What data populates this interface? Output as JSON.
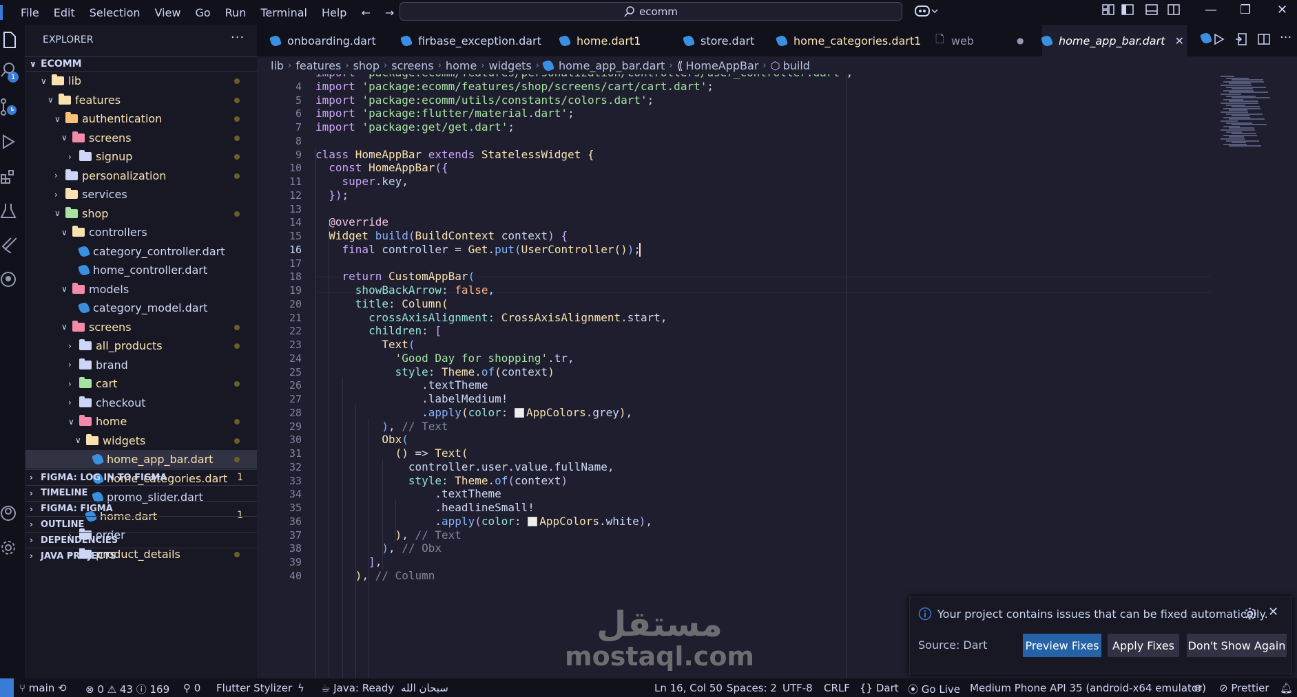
{
  "titlebar": {
    "menu": [
      "File",
      "Edit",
      "Selection",
      "View",
      "Go",
      "Run",
      "Terminal",
      "Help"
    ],
    "search": "ecomm"
  },
  "activity": {
    "badge": "1"
  },
  "sidebar": {
    "title": "EXPLORER",
    "more": "···",
    "root": "ECOMM",
    "tree": [
      {
        "label": "lib",
        "depth": 1,
        "type": "folder",
        "open": true,
        "dot": true,
        "color": "#f9e2af"
      },
      {
        "label": "features",
        "depth": 2,
        "type": "folder",
        "open": true,
        "dot": true,
        "color": "#f9e2af"
      },
      {
        "label": "authentication",
        "depth": 3,
        "type": "folder",
        "open": true,
        "dot": true,
        "color": "#f9c27a"
      },
      {
        "label": "screens",
        "depth": 4,
        "type": "folder",
        "open": true,
        "dot": true,
        "color": "#f38ba8"
      },
      {
        "label": "signup",
        "depth": 5,
        "type": "folder",
        "open": false,
        "dot": true,
        "color": "#cdd6f4"
      },
      {
        "label": "personalization",
        "depth": 3,
        "type": "folder",
        "open": false,
        "dot": true,
        "color": "#cdd6f4"
      },
      {
        "label": "services",
        "depth": 3,
        "type": "folder",
        "open": false,
        "dot": false,
        "color": "#f9e2af"
      },
      {
        "label": "shop",
        "depth": 3,
        "type": "folder",
        "open": true,
        "dot": true,
        "color": "#a6e3a1"
      },
      {
        "label": "controllers",
        "depth": 4,
        "type": "folder",
        "open": true,
        "dot": false,
        "color": "#f9e2af"
      },
      {
        "label": "category_controller.dart",
        "depth": 5,
        "type": "dart",
        "dot": false
      },
      {
        "label": "home_controller.dart",
        "depth": 5,
        "type": "dart",
        "dot": false
      },
      {
        "label": "models",
        "depth": 4,
        "type": "folder",
        "open": true,
        "dot": false,
        "color": "#f38ba8"
      },
      {
        "label": "category_model.dart",
        "depth": 5,
        "type": "dart",
        "dot": false
      },
      {
        "label": "screens",
        "depth": 4,
        "type": "folder",
        "open": true,
        "dot": true,
        "color": "#f38ba8"
      },
      {
        "label": "all_products",
        "depth": 5,
        "type": "folder",
        "open": false,
        "dot": true,
        "color": "#cdd6f4"
      },
      {
        "label": "brand",
        "depth": 5,
        "type": "folder",
        "open": false,
        "dot": false,
        "color": "#cdd6f4"
      },
      {
        "label": "cart",
        "depth": 5,
        "type": "folder",
        "open": false,
        "dot": true,
        "color": "#a6e3a1"
      },
      {
        "label": "checkout",
        "depth": 5,
        "type": "folder",
        "open": false,
        "dot": false,
        "color": "#cdd6f4"
      },
      {
        "label": "home",
        "depth": 5,
        "type": "folder",
        "open": true,
        "dot": true,
        "color": "#f38ba8"
      },
      {
        "label": "widgets",
        "depth": 6,
        "type": "folder",
        "open": true,
        "dot": true,
        "color": "#f9e2af"
      },
      {
        "label": "home_app_bar.dart",
        "depth": 7,
        "type": "dart",
        "dot": true,
        "selected": true
      },
      {
        "label": "home_categories.dart",
        "depth": 7,
        "type": "dart",
        "num": "1"
      },
      {
        "label": "promo_slider.dart",
        "depth": 7,
        "type": "dart",
        "dot": false
      },
      {
        "label": "home.dart",
        "depth": 6,
        "type": "dart",
        "num": "1"
      },
      {
        "label": "order",
        "depth": 5,
        "type": "folder",
        "open": false,
        "dot": false,
        "color": "#cdd6f4"
      },
      {
        "label": "product_details",
        "depth": 5,
        "type": "folder",
        "open": false,
        "dot": true,
        "color": "#cdd6f4"
      }
    ],
    "panels": [
      "FIGMA: LOG IN TO FIGMA",
      "TIMELINE",
      "FIGMA: FIGMA",
      "OUTLINE",
      "DEPENDENCIES",
      "JAVA PROJECTS"
    ]
  },
  "tabs": [
    {
      "label": "onboarding.dart",
      "suffix": "",
      "color": "#cdd6f4",
      "icon": "dart"
    },
    {
      "label": "firbase_exception.dart",
      "suffix": "",
      "color": "#cdd6f4",
      "icon": "dart"
    },
    {
      "label": "home.dart",
      "suffix": " 1",
      "color": "#f9e2af",
      "icon": "dart"
    },
    {
      "label": "store.dart",
      "suffix": "",
      "color": "#cdd6f4",
      "icon": "dart"
    },
    {
      "label": "home_categories.dart",
      "suffix": " 1",
      "color": "#f9e2af",
      "icon": "dart"
    },
    {
      "label": "web",
      "suffix": "",
      "color": "#9399b2",
      "icon": "file"
    },
    {
      "label": "home_app_bar.dart",
      "suffix": "",
      "color": "#ffffff",
      "icon": "dart",
      "active": true
    }
  ],
  "breadcrumb": [
    "lib",
    "features",
    "shop",
    "screens",
    "home",
    "widgets",
    "home_app_bar.dart",
    "HomeAppBar",
    "build"
  ],
  "editor": {
    "line_start": 3,
    "current_line": 16,
    "lines": [
      [
        [
          "kw",
          "import "
        ],
        [
          "st",
          "'package:ecomm/features/personalization/controllers/user_controller.dart'"
        ],
        [
          "pr",
          ";"
        ]
      ],
      [
        [
          "kw",
          "import "
        ],
        [
          "st",
          "'package:ecomm/features/shop/screens/cart/cart.dart'"
        ],
        [
          "pr",
          ";"
        ]
      ],
      [
        [
          "kw",
          "import "
        ],
        [
          "st",
          "'package:ecomm/utils/constants/colors.dart'"
        ],
        [
          "pr",
          ";"
        ]
      ],
      [
        [
          "kw",
          "import "
        ],
        [
          "st",
          "'package:flutter/material.dart'"
        ],
        [
          "pr",
          ";"
        ]
      ],
      [
        [
          "kw",
          "import "
        ],
        [
          "st",
          "'package:get/get.dart'"
        ],
        [
          "pr",
          ";"
        ]
      ],
      [],
      [
        [
          "kw",
          "class "
        ],
        [
          "ty",
          "HomeAppBar "
        ],
        [
          "kw",
          "extends "
        ],
        [
          "ty",
          "StatelessWidget "
        ],
        [
          "br1",
          "{"
        ]
      ],
      [
        [
          "pr",
          "  "
        ],
        [
          "kw",
          "const "
        ],
        [
          "ty",
          "HomeAppBar"
        ],
        [
          "br2",
          "({"
        ]
      ],
      [
        [
          "pr",
          "    "
        ],
        [
          "kw",
          "super"
        ],
        [
          "pr",
          ".key,"
        ]
      ],
      [
        [
          "pr",
          "  "
        ],
        [
          "br2",
          "})"
        ],
        [
          "pr",
          ";"
        ]
      ],
      [],
      [
        [
          "pr",
          "  "
        ],
        [
          "an",
          "@override"
        ]
      ],
      [
        [
          "pr",
          "  "
        ],
        [
          "ty",
          "Widget "
        ],
        [
          "fn",
          "build"
        ],
        [
          "br2",
          "("
        ],
        [
          "ty",
          "BuildContext "
        ],
        [
          "pr",
          "context"
        ],
        [
          "br2",
          ")"
        ],
        [
          "pr",
          " "
        ],
        [
          "br2",
          "{"
        ]
      ],
      [
        [
          "pr",
          "    "
        ],
        [
          "kw",
          "final "
        ],
        [
          "pr",
          "controller = "
        ],
        [
          "ty",
          "Get"
        ],
        [
          "pr",
          "."
        ],
        [
          "fn",
          "put"
        ],
        [
          "br3",
          "("
        ],
        [
          "ty",
          "UserController"
        ],
        [
          "br1",
          "()"
        ],
        [
          "br3",
          ")"
        ],
        [
          "pr",
          ";"
        ]
      ],
      [],
      [
        [
          "pr",
          "    "
        ],
        [
          "kw",
          "return "
        ],
        [
          "ty",
          "CustomAppBar"
        ],
        [
          "br3",
          "("
        ]
      ],
      [
        [
          "pr",
          "      "
        ],
        [
          "pn",
          "showBackArrow"
        ],
        [
          "pr",
          ": "
        ],
        [
          "bo",
          "false"
        ],
        [
          "pr",
          ","
        ]
      ],
      [
        [
          "pr",
          "      "
        ],
        [
          "pn",
          "title"
        ],
        [
          "pr",
          ": "
        ],
        [
          "ty",
          "Column"
        ],
        [
          "br1",
          "("
        ]
      ],
      [
        [
          "pr",
          "        "
        ],
        [
          "pn",
          "crossAxisAlignment"
        ],
        [
          "pr",
          ": "
        ],
        [
          "ty",
          "CrossAxisAlignment"
        ],
        [
          "pr",
          ".start,"
        ]
      ],
      [
        [
          "pr",
          "        "
        ],
        [
          "pn",
          "children"
        ],
        [
          "pr",
          ": "
        ],
        [
          "br2",
          "["
        ]
      ],
      [
        [
          "pr",
          "          "
        ],
        [
          "ty",
          "Text"
        ],
        [
          "br3",
          "("
        ]
      ],
      [
        [
          "pr",
          "            "
        ],
        [
          "st",
          "'Good Day for shopping'"
        ],
        [
          "pr",
          ".tr,"
        ]
      ],
      [
        [
          "pr",
          "            "
        ],
        [
          "pn",
          "style"
        ],
        [
          "pr",
          ": "
        ],
        [
          "ty",
          "Theme"
        ],
        [
          "pr",
          "."
        ],
        [
          "fn",
          "of"
        ],
        [
          "br1",
          "("
        ],
        [
          "pr",
          "context"
        ],
        [
          "br1",
          ")"
        ]
      ],
      [
        [
          "pr",
          "                ."
        ],
        [
          "pr",
          "textTheme"
        ]
      ],
      [
        [
          "pr",
          "                ."
        ],
        [
          "pr",
          "labelMedium!"
        ]
      ],
      [
        [
          "pr",
          "                ."
        ],
        [
          "fn",
          "apply"
        ],
        [
          "br1",
          "("
        ],
        [
          "pn",
          "color"
        ],
        [
          "pr",
          ": "
        ],
        [
          "sw",
          ""
        ],
        [
          "ty",
          "AppColors"
        ],
        [
          "pr",
          ".grey"
        ],
        [
          "br1",
          ")"
        ],
        [
          "pr",
          ","
        ]
      ],
      [
        [
          "pr",
          "          "
        ],
        [
          "br3",
          ")"
        ],
        [
          "pr",
          ", "
        ],
        [
          "cm",
          "// Text"
        ]
      ],
      [
        [
          "pr",
          "          "
        ],
        [
          "ty",
          "Obx"
        ],
        [
          "br3",
          "("
        ]
      ],
      [
        [
          "pr",
          "            "
        ],
        [
          "br1",
          "()"
        ],
        [
          "pr",
          " => "
        ],
        [
          "ty",
          "Text"
        ],
        [
          "br1",
          "("
        ]
      ],
      [
        [
          "pr",
          "              "
        ],
        [
          "pr",
          "controller.user.value.fullName,"
        ]
      ],
      [
        [
          "pr",
          "              "
        ],
        [
          "pn",
          "style"
        ],
        [
          "pr",
          ": "
        ],
        [
          "ty",
          "Theme"
        ],
        [
          "pr",
          "."
        ],
        [
          "fn",
          "of"
        ],
        [
          "br2",
          "("
        ],
        [
          "pr",
          "context"
        ],
        [
          "br2",
          ")"
        ]
      ],
      [
        [
          "pr",
          "                  ."
        ],
        [
          "pr",
          "textTheme"
        ]
      ],
      [
        [
          "pr",
          "                  ."
        ],
        [
          "pr",
          "headlineSmall!"
        ]
      ],
      [
        [
          "pr",
          "                  ."
        ],
        [
          "fn",
          "apply"
        ],
        [
          "br2",
          "("
        ],
        [
          "pn",
          "color"
        ],
        [
          "pr",
          ": "
        ],
        [
          "sw",
          ""
        ],
        [
          "ty",
          "AppColors"
        ],
        [
          "pr",
          ".white"
        ],
        [
          "br2",
          ")"
        ],
        [
          "pr",
          ","
        ]
      ],
      [
        [
          "pr",
          "            "
        ],
        [
          "br1",
          ")"
        ],
        [
          "pr",
          ", "
        ],
        [
          "cm",
          "// Text"
        ]
      ],
      [
        [
          "pr",
          "          "
        ],
        [
          "br3",
          ")"
        ],
        [
          "pr",
          ", "
        ],
        [
          "cm",
          "// Obx"
        ]
      ],
      [
        [
          "pr",
          "        "
        ],
        [
          "br2",
          "]"
        ],
        [
          "pr",
          ","
        ]
      ],
      [
        [
          "pr",
          "      "
        ],
        [
          "br1",
          ")"
        ],
        [
          "pr",
          ", "
        ],
        [
          "cm",
          "// Column"
        ]
      ]
    ]
  },
  "notification": {
    "message": "Your project contains issues that can be fixed automatically.",
    "source": "Source: Dart",
    "buttons": [
      "Preview Fixes",
      "Apply Fixes",
      "Don't Show Again"
    ]
  },
  "watermark": {
    "arabic": "مستقل",
    "latin": "mostaql.com"
  },
  "statusbar": {
    "branch": "main",
    "errors": "0",
    "warnings": "43",
    "infos": "169",
    "ports": "0",
    "stylizer": "Flutter Stylizer",
    "java": "Java: Ready",
    "arabic": "سبحان الله",
    "position": "Ln 16, Col 50",
    "spaces": "Spaces: 2",
    "encoding": "UTF-8",
    "eol": "CRLF",
    "language": "Dart",
    "golive": "Go Live",
    "device": "Medium Phone API 35 (android-x64 emulator)",
    "prettier": "Prettier"
  }
}
